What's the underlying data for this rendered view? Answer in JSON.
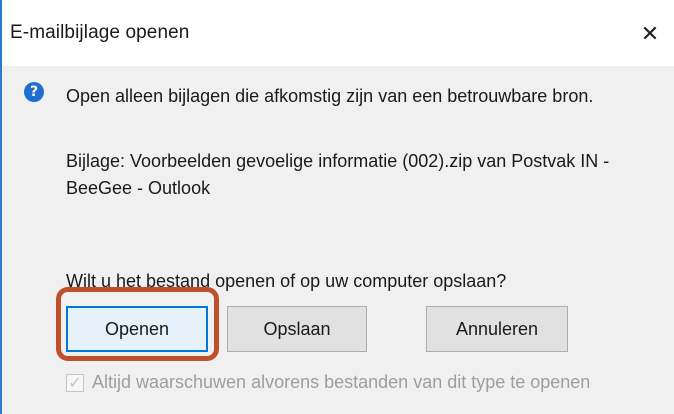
{
  "window": {
    "title": "E-mailbijlage openen",
    "close_icon": "close-icon",
    "close_glyph": "✕"
  },
  "message": {
    "icon": "help-icon",
    "icon_glyph": "?",
    "text": "Open alleen bijlagen die afkomstig zijn van een betrouwbare bron."
  },
  "attachment": {
    "text": "Bijlage: Voorbeelden gevoelige informatie (002).zip van Postvak IN - BeeGee - Outlook"
  },
  "question": {
    "text": "Wilt u het bestand openen of op uw computer opslaan?"
  },
  "buttons": {
    "open_label": "Openen",
    "save_label": "Opslaan",
    "cancel_label": "Annuleren"
  },
  "checkbox": {
    "label": "Altijd waarschuwen alvorens bestanden van dit type te openen",
    "checked": true,
    "check_glyph": "✓"
  },
  "colors": {
    "accent": "#0078d7",
    "highlight": "#c0502a",
    "info_icon": "#1f6fd0"
  }
}
